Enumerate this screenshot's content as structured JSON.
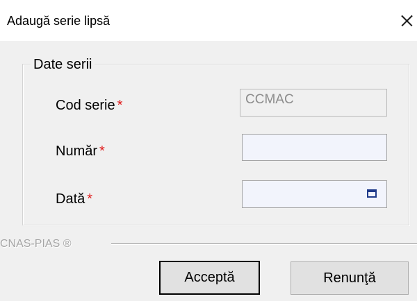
{
  "window": {
    "title": "Adaugă serie lipsă",
    "close_icon": "close-icon"
  },
  "group": {
    "legend": "Date serii"
  },
  "fields": {
    "cod_serie": {
      "label": "Cod serie",
      "required_mark": "*",
      "value": "CCMAC",
      "disabled": true
    },
    "numar": {
      "label": "Număr",
      "required_mark": "*",
      "value": ""
    },
    "data": {
      "label": "Dată",
      "required_mark": "*",
      "value": "",
      "picker_icon": "calendar-icon"
    }
  },
  "footer": {
    "brand": "CNAS-PIAS ®"
  },
  "buttons": {
    "accept": "Acceptă",
    "cancel": "Renunţă"
  },
  "colors": {
    "required_mark": "#e01b1b",
    "dialog_bg": "#f0f0f0",
    "titlebar_bg": "#ffffff",
    "input_bg": "#f2f4fc",
    "calendar_icon": "#1f3a8a"
  }
}
